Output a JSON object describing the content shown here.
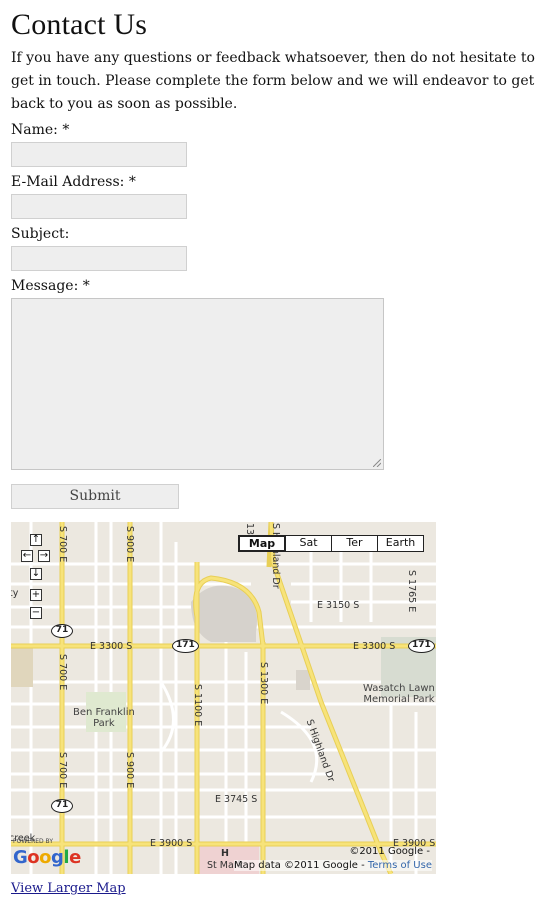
{
  "page": {
    "title": "Contact Us",
    "intro": "If you have any questions or feedback whatsoever, then do not hesitate to get in touch. Please complete the form below and we will endeavor to get back to you as soon as possible."
  },
  "form": {
    "name_label": "Name: *",
    "email_label": "E-Mail Address: *",
    "subject_label": "Subject:",
    "message_label": "Message: *",
    "submit_label": "Submit",
    "name_value": "",
    "email_value": "",
    "subject_value": "",
    "message_value": ""
  },
  "map": {
    "types": [
      "Map",
      "Sat",
      "Ter",
      "Earth"
    ],
    "selected_type": "Map",
    "controls": {
      "up": "↑",
      "left": "←",
      "right": "→",
      "down": "↓",
      "zoom_in": "+",
      "zoom_out": "−"
    },
    "streets": {
      "s700e": "S 700 E",
      "s900e": "S 900 E",
      "s1100e": "S 1100 E",
      "s1300e": "S 1300 E",
      "highland": "S Highland Dr",
      "highland_top": "S Highland Dr",
      "s1765e": "S 1765 E",
      "e3150s": "E 3150 S",
      "e3300s": "E 3300 S",
      "e3745s": "E 3745 S",
      "e3900s": "E 3900 S",
      "s13": "13"
    },
    "shields": {
      "r71": "71",
      "r171": "171"
    },
    "places": {
      "ben_franklin": "Ben Franklin\nPark",
      "wasatch": "Wasatch Lawn\nMemorial Park",
      "st_mark": "St Mark",
      "hospital": "H",
      "creek": "creek",
      "left_fragment": "ty"
    },
    "powered_by": "POWERED BY",
    "google": "Google",
    "copyright": "©2011 Google -",
    "map_data": "Map data ©2011 Google - ",
    "terms": "Terms of Use"
  },
  "links": {
    "view_larger_map": "View Larger Map"
  },
  "colors": {
    "field_bg": "#eeeeee",
    "map_bg": "#ece8e0",
    "road_yellow": "#f7e37a",
    "link": "#1a1a8c"
  }
}
